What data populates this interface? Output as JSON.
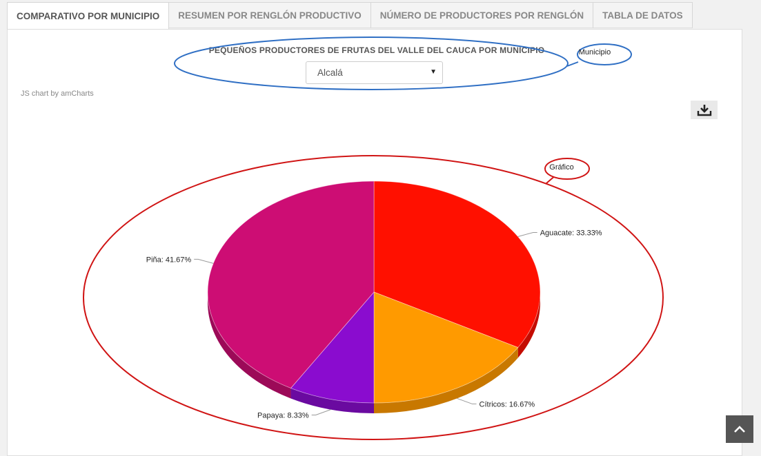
{
  "tabs": [
    {
      "label": "COMPARATIVO POR MUNICIPIO",
      "active": true
    },
    {
      "label": "RESUMEN POR RENGLÓN PRODUCTIVO",
      "active": false
    },
    {
      "label": "NÚMERO DE PRODUCTORES POR RENGLÓN",
      "active": false
    },
    {
      "label": "TABLA DE DATOS",
      "active": false
    }
  ],
  "panel": {
    "title": "PEQUEÑOS PRODUCTORES DE FRUTAS DEL VALLE DEL CAUCA POR MUNICIPIO",
    "municipio_select": {
      "value": "Alcalá"
    },
    "credit": "JS chart by amCharts",
    "export_icon": "download-icon"
  },
  "annotations": {
    "municipio_callout": "Municipio",
    "grafico_callout": "Gráfico",
    "municipio_color": "#2f6fc4",
    "grafico_color": "#d01414"
  },
  "chart_data": {
    "type": "pie",
    "style": "3d",
    "slices": [
      {
        "label": "Aguacate",
        "value": 33.33,
        "color": "#ff1000",
        "dark": "#c40c00"
      },
      {
        "label": "Cítricos",
        "value": 16.67,
        "color": "#ff9a00",
        "dark": "#c87800"
      },
      {
        "label": "Papaya",
        "value": 8.33,
        "color": "#8a0ccf",
        "dark": "#6a0aa0"
      },
      {
        "label": "Piña",
        "value": 41.67,
        "color": "#cd0d74",
        "dark": "#9c0a58"
      }
    ]
  },
  "scroll_top_icon": "chevron-up-icon"
}
